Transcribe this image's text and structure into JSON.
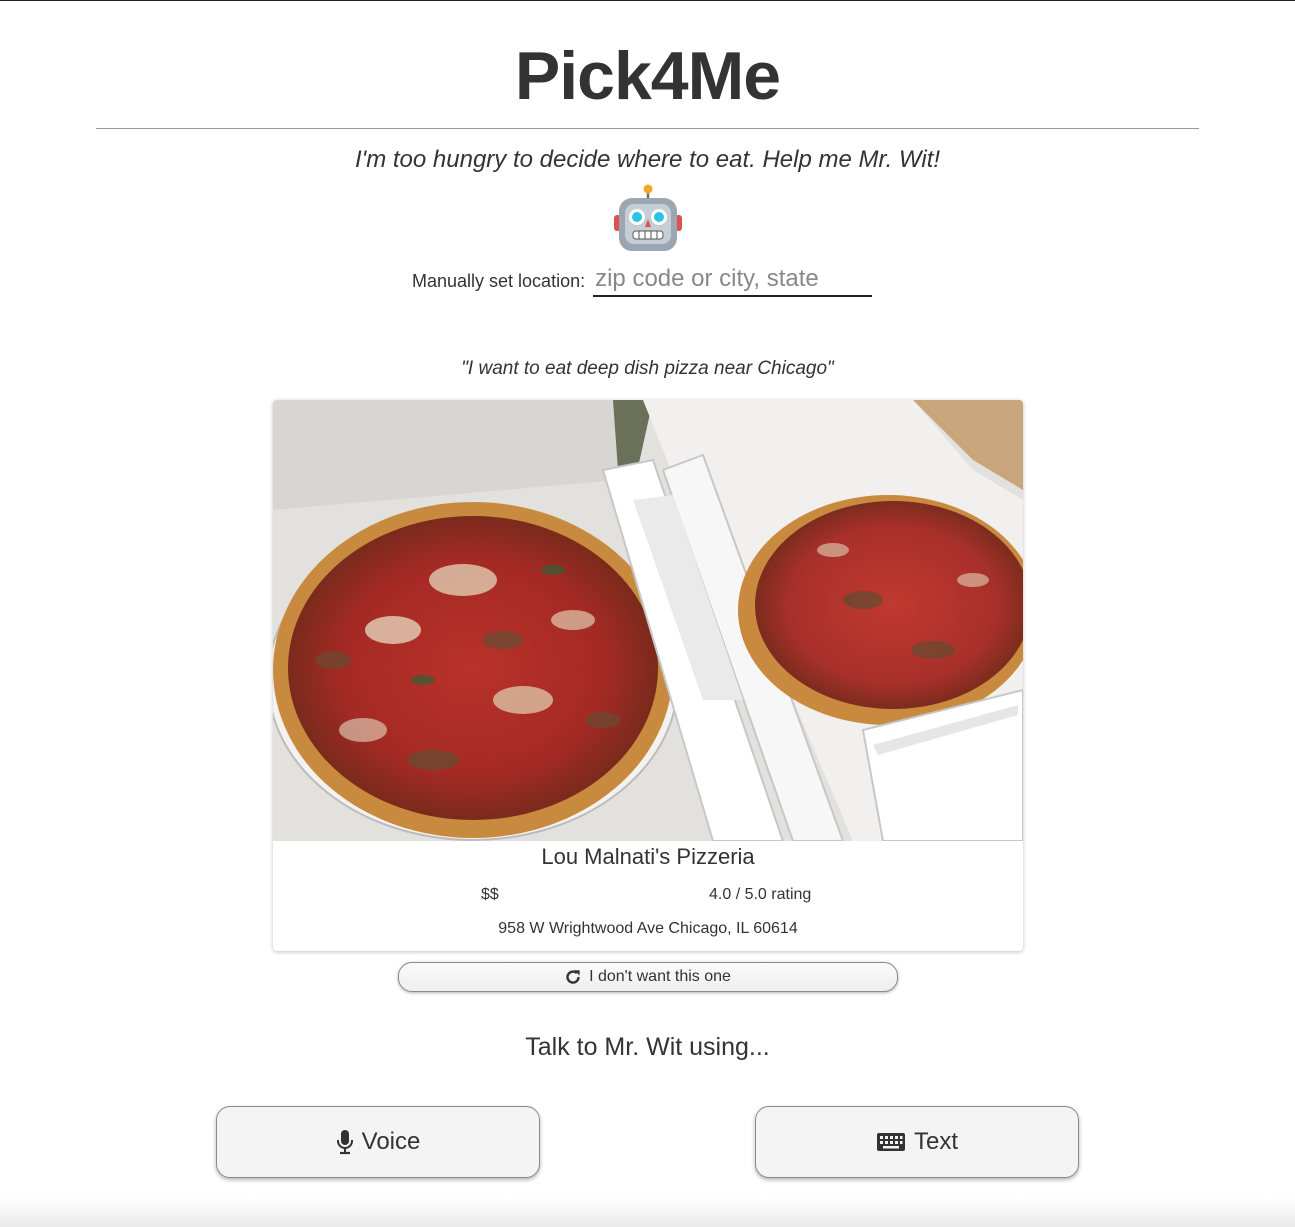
{
  "header": {
    "title": "Pick4Me",
    "subtitle": "I'm too hungry to decide where to eat. Help me Mr. Wit!"
  },
  "mascot": {
    "icon": "robot-icon"
  },
  "location": {
    "label": "Manually set location:",
    "value": "",
    "placeholder": "zip code or city, state"
  },
  "query": {
    "text": "\"I want to eat deep dish pizza near Chicago\""
  },
  "result": {
    "name": "Lou Malnati's Pizzeria",
    "price": "$$",
    "rating": "4.0 / 5.0 rating",
    "address": "958 W Wrightwood Ave Chicago, IL 60614",
    "photo": "deep-dish-pizza-photo"
  },
  "actions": {
    "reject_label": "I don't want this one",
    "reject_icon": "refresh-icon"
  },
  "talk": {
    "prompt": "Talk to Mr. Wit using...",
    "voice_label": "Voice",
    "voice_icon": "microphone-icon",
    "text_label": "Text",
    "text_icon": "keyboard-icon"
  },
  "colors": {
    "text": "#333333",
    "background": "#ffffff",
    "button_bg": "#f4f4f4",
    "border": "#888888"
  }
}
